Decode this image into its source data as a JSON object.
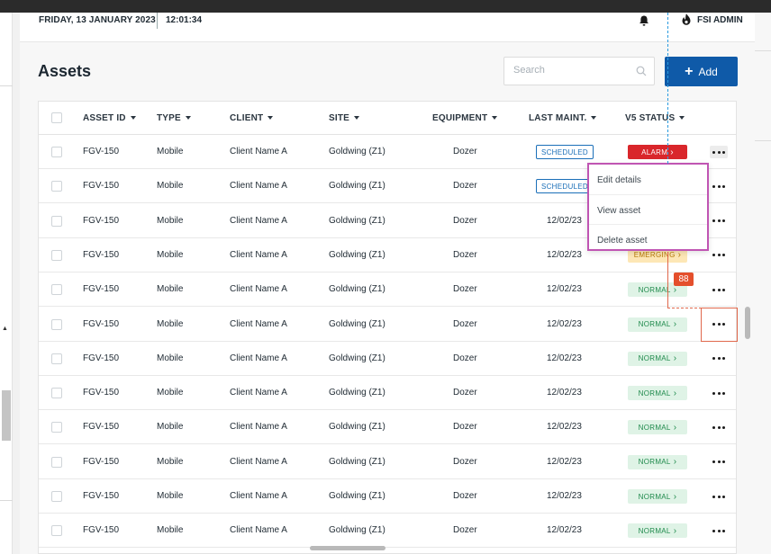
{
  "header": {
    "date": "FRIDAY, 13 JANUARY 2023",
    "time": "12:01:34",
    "user_name": "FSI ADMIN",
    "bell_icon": "bell-icon",
    "user_icon": "flame-logo-icon"
  },
  "page": {
    "title": "Assets",
    "search_placeholder": "Search",
    "search_value": "",
    "add_label": "Add"
  },
  "table": {
    "columns": [
      "ASSET ID",
      "TYPE",
      "CLIENT",
      "SITE",
      "EQUIPMENT",
      "LAST MAINT.",
      "V5 STATUS"
    ],
    "rows": [
      {
        "asset_id": "FGV-150",
        "type": "Mobile",
        "client": "Client Name A",
        "site": "Goldwing (Z1)",
        "equipment": "Dozer",
        "last_maint": "SCHEDULED",
        "last_maint_kind": "scheduled",
        "status": "ALARM",
        "status_kind": "alarm"
      },
      {
        "asset_id": "FGV-150",
        "type": "Mobile",
        "client": "Client Name A",
        "site": "Goldwing (Z1)",
        "equipment": "Dozer",
        "last_maint": "SCHEDULED",
        "last_maint_kind": "scheduled",
        "status": "",
        "status_kind": "hidden"
      },
      {
        "asset_id": "FGV-150",
        "type": "Mobile",
        "client": "Client Name A",
        "site": "Goldwing (Z1)",
        "equipment": "Dozer",
        "last_maint": "12/02/23",
        "last_maint_kind": "date",
        "status": "",
        "status_kind": "hidden"
      },
      {
        "asset_id": "FGV-150",
        "type": "Mobile",
        "client": "Client Name A",
        "site": "Goldwing (Z1)",
        "equipment": "Dozer",
        "last_maint": "12/02/23",
        "last_maint_kind": "date",
        "status": "EMERGING",
        "status_kind": "emerging"
      },
      {
        "asset_id": "FGV-150",
        "type": "Mobile",
        "client": "Client Name A",
        "site": "Goldwing (Z1)",
        "equipment": "Dozer",
        "last_maint": "12/02/23",
        "last_maint_kind": "date",
        "status": "NORMAL",
        "status_kind": "normal"
      },
      {
        "asset_id": "FGV-150",
        "type": "Mobile",
        "client": "Client Name A",
        "site": "Goldwing (Z1)",
        "equipment": "Dozer",
        "last_maint": "12/02/23",
        "last_maint_kind": "date",
        "status": "NORMAL",
        "status_kind": "normal"
      },
      {
        "asset_id": "FGV-150",
        "type": "Mobile",
        "client": "Client Name A",
        "site": "Goldwing (Z1)",
        "equipment": "Dozer",
        "last_maint": "12/02/23",
        "last_maint_kind": "date",
        "status": "NORMAL",
        "status_kind": "normal"
      },
      {
        "asset_id": "FGV-150",
        "type": "Mobile",
        "client": "Client Name A",
        "site": "Goldwing (Z1)",
        "equipment": "Dozer",
        "last_maint": "12/02/23",
        "last_maint_kind": "date",
        "status": "NORMAL",
        "status_kind": "normal"
      },
      {
        "asset_id": "FGV-150",
        "type": "Mobile",
        "client": "Client Name A",
        "site": "Goldwing (Z1)",
        "equipment": "Dozer",
        "last_maint": "12/02/23",
        "last_maint_kind": "date",
        "status": "NORMAL",
        "status_kind": "normal"
      },
      {
        "asset_id": "FGV-150",
        "type": "Mobile",
        "client": "Client Name A",
        "site": "Goldwing (Z1)",
        "equipment": "Dozer",
        "last_maint": "12/02/23",
        "last_maint_kind": "date",
        "status": "NORMAL",
        "status_kind": "normal"
      },
      {
        "asset_id": "FGV-150",
        "type": "Mobile",
        "client": "Client Name A",
        "site": "Goldwing (Z1)",
        "equipment": "Dozer",
        "last_maint": "12/02/23",
        "last_maint_kind": "date",
        "status": "NORMAL",
        "status_kind": "normal"
      },
      {
        "asset_id": "FGV-150",
        "type": "Mobile",
        "client": "Client Name A",
        "site": "Goldwing (Z1)",
        "equipment": "Dozer",
        "last_maint": "12/02/23",
        "last_maint_kind": "date",
        "status": "NORMAL",
        "status_kind": "normal"
      }
    ]
  },
  "row_menu": {
    "items": [
      "Edit details",
      "View asset",
      "Delete asset"
    ]
  },
  "annotation": {
    "spacing_label": "88"
  },
  "colors": {
    "primary": "#0f5aa8",
    "alarm": "#d9262b",
    "normal_bg": "#dff3e6",
    "normal_text": "#1f8a4c",
    "emerging_bg": "#fde7b6",
    "scheduled": "#1b6fb8",
    "menu_border": "#c055b3",
    "annotation": "#e44f2c"
  }
}
